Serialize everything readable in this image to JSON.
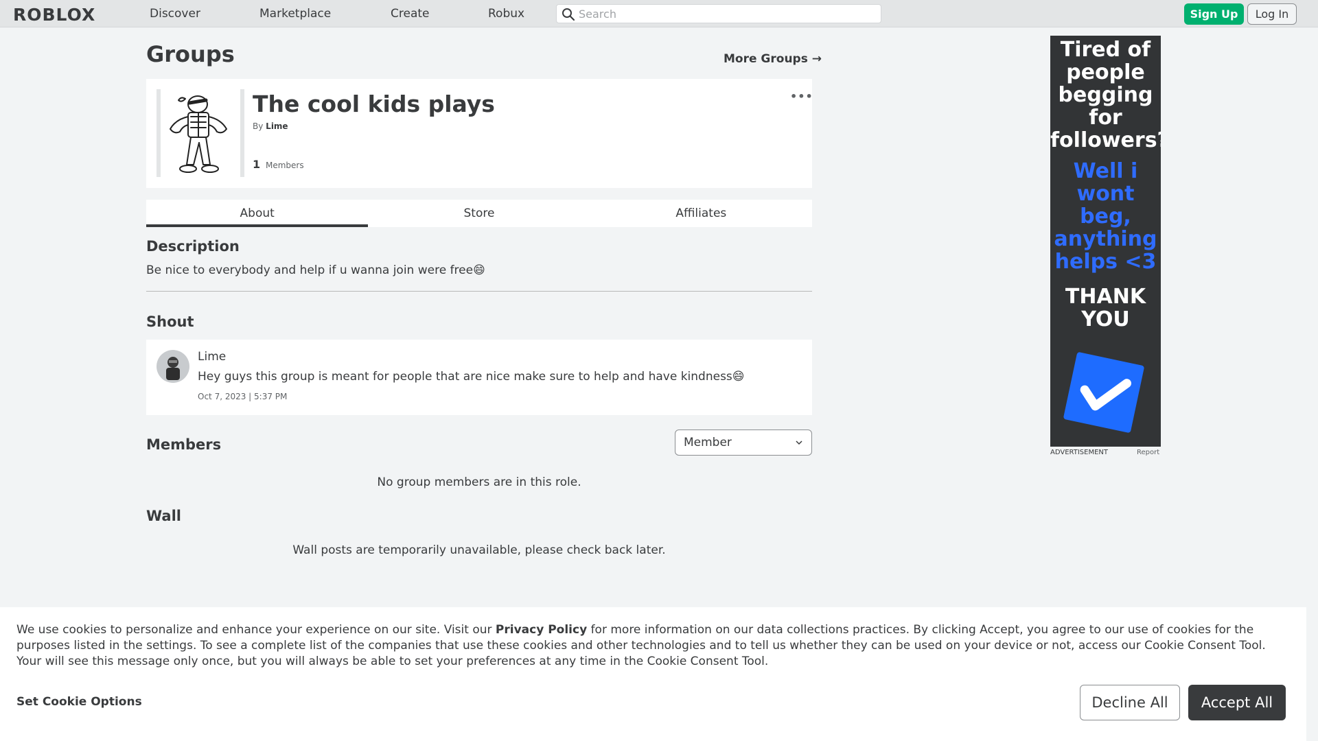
{
  "header": {
    "logo": "ROBLOX",
    "nav": [
      "Discover",
      "Marketplace",
      "Create",
      "Robux"
    ],
    "search_placeholder": "Search",
    "signup_label": "Sign Up",
    "login_label": "Log In"
  },
  "page": {
    "title": "Groups",
    "more_groups_label": "More Groups →"
  },
  "group": {
    "name": "The cool kids plays",
    "by_label": "By",
    "owner": "Lime",
    "member_count": "1",
    "members_label": "Members",
    "more_menu": "•••"
  },
  "tabs": [
    "About",
    "Store",
    "Affiliates"
  ],
  "description": {
    "heading": "Description",
    "text": "Be nice to everybody and help if u wanna join were free😄"
  },
  "shout": {
    "heading": "Shout",
    "user": "Lime",
    "body": "Hey guys this group is meant for people that are nice make sure to help and have kindness😄",
    "time": "Oct 7, 2023 | 5:37 PM"
  },
  "members": {
    "heading": "Members",
    "role_selected": "Member",
    "empty_text": "No group members are in this role."
  },
  "wall": {
    "heading": "Wall",
    "unavailable_text": "Wall posts are temporarily unavailable, please check back later."
  },
  "ad": {
    "lines_white_1": [
      "Tired of",
      "people",
      "begging",
      "for",
      "followers?"
    ],
    "lines_blue": [
      "Well i",
      "wont beg,",
      "anything",
      "helps <3"
    ],
    "lines_white_2": [
      "THANK",
      "YOU"
    ],
    "label": "ADVERTISEMENT",
    "report": "Report"
  },
  "cookie": {
    "text_before_link": "We use cookies to personalize and enhance your experience on our site. Visit our ",
    "link": "Privacy Policy",
    "text_after_link": " for more information on our data collections practices. By clicking Accept, you agree to our use of cookies for the purposes listed in the settings. To see a complete list of the companies that use these cookies and other technologies and to tell us whether they can be used on your device or not, access our Cookie Consent Tool. Your will see this message only once, but you will always be able to set your preferences at any time in the Cookie Consent Tool.",
    "options_label": "Set Cookie Options",
    "decline_label": "Decline All",
    "accept_label": "Accept All"
  },
  "colors": {
    "signup_green": "#00b06f",
    "ad_blue": "#2f6cff",
    "dark": "#393b3d"
  }
}
